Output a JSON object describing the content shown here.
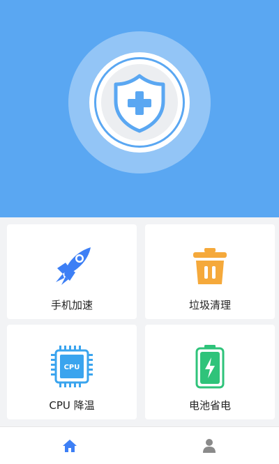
{
  "colors": {
    "hero_background": "#5aa7f2",
    "accent_blue": "#3d7ff5",
    "trash_orange": "#f5a93b",
    "battery_green": "#2fc37a",
    "cpu_blue": "#3aa4ee",
    "tab_active": "#3d7ff5",
    "tab_inactive": "#8a8a8a"
  },
  "hero": {
    "icon": "shield-plus-icon"
  },
  "features": [
    {
      "label": "手机加速",
      "icon": "rocket-icon"
    },
    {
      "label": "垃圾清理",
      "icon": "trash-icon"
    },
    {
      "label": "CPU 降温",
      "icon": "cpu-icon",
      "chip_text": "CPU"
    },
    {
      "label": "电池省电",
      "icon": "battery-icon"
    }
  ],
  "tabbar": {
    "tabs": [
      {
        "icon": "home-icon",
        "active": true
      },
      {
        "icon": "user-icon",
        "active": false
      }
    ]
  }
}
